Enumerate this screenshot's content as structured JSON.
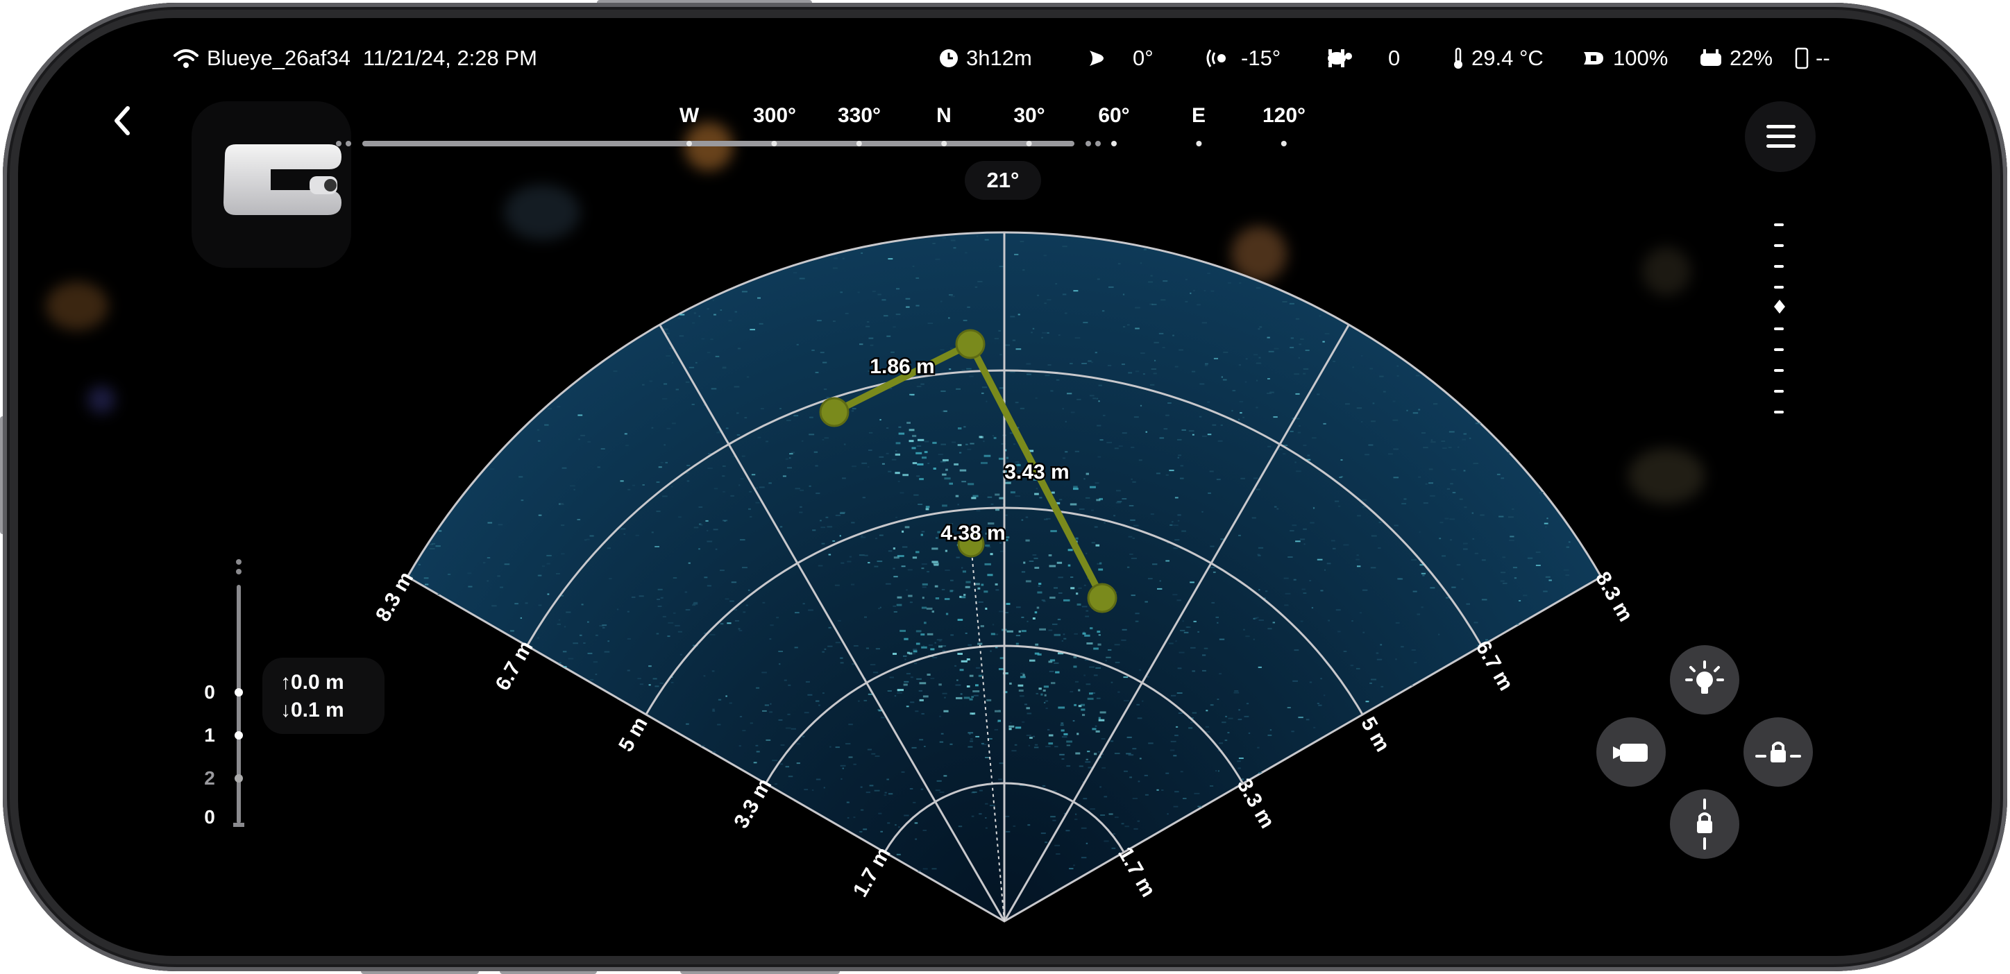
{
  "status_bar": {
    "wifi_icon": "wifi-icon",
    "drone_name": "Blueye_26af34",
    "datetime": "11/21/24, 2:28 PM",
    "dive_time": "3h12m",
    "tilt": "0°",
    "camera_tilt": "-15°",
    "speed": "0",
    "temperature": "29.4 °C",
    "drone_battery": "100%",
    "controller_battery": "22%",
    "phone_battery": "--"
  },
  "compass": {
    "labels": [
      "W",
      "300°",
      "330°",
      "N",
      "30°",
      "60°",
      "E",
      "120°"
    ],
    "heading": "21°"
  },
  "depth": {
    "up": "↑0.0 m",
    "down": "↓0.1 m",
    "scale": [
      "0",
      "1",
      "2",
      "0"
    ]
  },
  "sonar": {
    "range_labels_left": [
      "8.3 m",
      "6.7 m",
      "5 m",
      "3.3 m",
      "1.7 m"
    ],
    "range_labels_right": [
      "8.3 m",
      "6.7 m",
      "5 m",
      "3.3 m",
      "1.7 m"
    ],
    "measurements": [
      "1.86 m",
      "3.43 m",
      "4.38 m"
    ],
    "accent_color": "#7a8a1c",
    "fan_color": "#0d3350"
  },
  "controls": {
    "light": "lightbulb-icon",
    "record": "video-camera-icon",
    "lock_horizontal": "lock-horizontal-icon",
    "lock_vertical": "lock-vertical-icon",
    "menu": "menu-icon"
  }
}
